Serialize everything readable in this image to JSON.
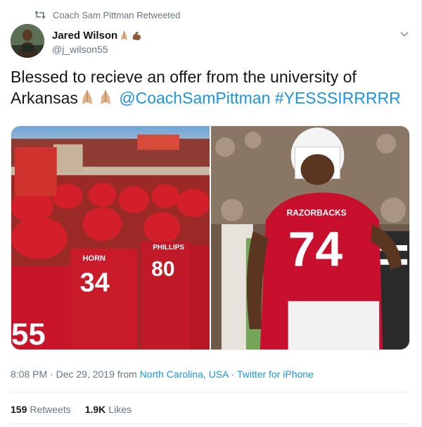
{
  "retweet_context": {
    "text": "Coach Sam Pittman Retweeted",
    "icon": "retweet-icon"
  },
  "author": {
    "display_name": "Jared Wilson",
    "handle": "@j_wilson55",
    "name_emojis": [
      "folded-hands-emoji",
      "flexed-biceps-emoji"
    ]
  },
  "tweet": {
    "text_line1": "Blessed to recieve an offer from the university of",
    "text_line2_start": "Arkansas",
    "mention": "@CoachSamPittman",
    "hashtag": "#YESSSIRRRRR",
    "inline_emojis": [
      "folded-hands-emoji",
      "folded-hands-emoji"
    ]
  },
  "media": {
    "photo_left_text": {
      "jersey_back_name": "HORN",
      "jersey_back_number": "34",
      "jersey_phillips": "PHILLIPS",
      "jersey_phillips_number": "80",
      "jersey_edge": "55"
    },
    "photo_right_text": {
      "jersey_brand": "RAZORBACKS",
      "jersey_number": "74"
    }
  },
  "meta": {
    "time": "8:08 PM",
    "date": "Dec 29, 2019",
    "from_label": "from",
    "location": "North Carolina, USA",
    "separator": "·",
    "source": "Twitter for iPhone"
  },
  "stats": {
    "retweets_count": "159",
    "retweets_label": "Retweets",
    "likes_count": "1.9K",
    "likes_label": "Likes"
  },
  "colors": {
    "link": "#1b95e0",
    "muted": "#657786",
    "text": "#14171a",
    "razorback_red": "#c8102e"
  }
}
